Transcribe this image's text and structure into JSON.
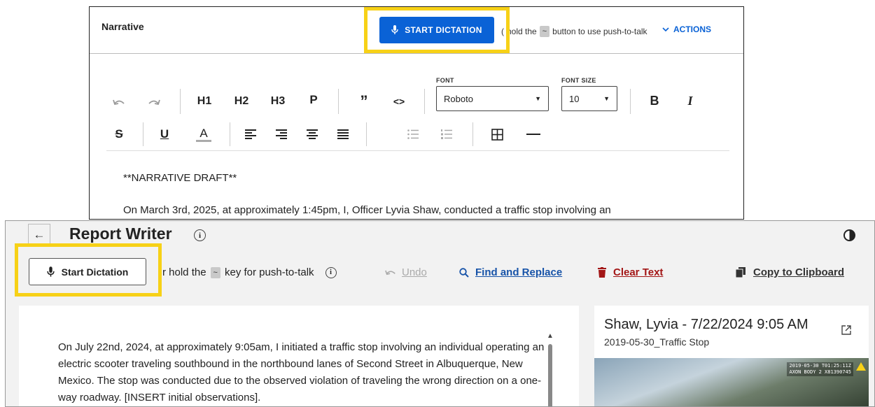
{
  "top_editor": {
    "section_title": "Narrative",
    "start_dictation_label": "START DICTATION",
    "ptt_prefix": "(",
    "ptt_middle": "hold the",
    "ptt_key": "~",
    "ptt_suffix": "button to use push-to-talk",
    "actions_label": "ACTIONS",
    "toolbar": {
      "h1": "H1",
      "h2": "H2",
      "h3": "H3",
      "p": "P",
      "quote": "”",
      "code": "<>",
      "font_label": "FONT",
      "font_value": "Roboto",
      "font_size_label": "FONT SIZE",
      "font_size_value": "10",
      "bold": "B",
      "italic": "I",
      "strike": "S",
      "underline": "U",
      "color": "A"
    },
    "draft_heading": "**NARRATIVE DRAFT**",
    "body_first_line": "On March 3rd, 2025, at approximately 1:45pm, I, Officer Lyvia Shaw, conducted a traffic stop involving an"
  },
  "report_writer": {
    "title": "Report Writer",
    "start_dictation_label": "Start Dictation",
    "ptt_prefix": "r hold the",
    "ptt_key": "~",
    "ptt_suffix": "key for push-to-talk",
    "undo_label": "Undo",
    "find_replace_label": "Find and Replace",
    "clear_text_label": "Clear Text",
    "copy_label": "Copy to Clipboard",
    "document_text": "On July 22nd, 2024, at approximately 9:05am, I initiated a traffic stop involving an individual operating an electric scooter traveling southbound in the northbound lanes of Second Street in Albuquerque, New Mexico. The stop was conducted due to the observed violation of traveling the wrong direction on a one-way roadway. [INSERT initial observations].",
    "video": {
      "title": "Shaw, Lyvia - 7/22/2024 9:05 AM",
      "subtitle": "2019-05-30_Traffic Stop",
      "overlay_line1": "2019-05-30 T01:25:11Z",
      "overlay_line2": "AXON BODY 2 X81390745"
    }
  },
  "colors": {
    "highlight": "#f7d117",
    "primary_blue": "#0a62d6",
    "link_blue": "#1753a8",
    "danger_red": "#a31616"
  }
}
